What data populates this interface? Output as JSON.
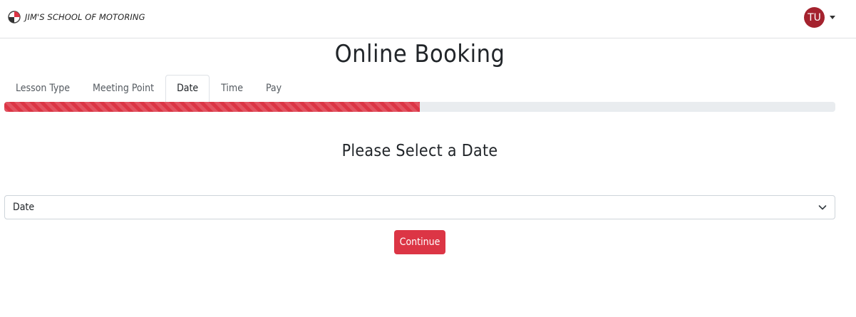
{
  "header": {
    "brand": "JIM'S SCHOOL OF MOTORING",
    "brand_logo": "steering-wheel-logo",
    "user_initials": "TU",
    "user_menu_icon": "caret-down-icon"
  },
  "page": {
    "title": "Online Booking"
  },
  "tabs": [
    {
      "label": "Lesson Type",
      "active": false
    },
    {
      "label": "Meeting Point",
      "active": false
    },
    {
      "label": "Date",
      "active": true
    },
    {
      "label": "Time",
      "active": false
    },
    {
      "label": "Pay",
      "active": false
    }
  ],
  "progress": {
    "percent": 50,
    "style": "striped"
  },
  "step": {
    "heading": "Please Select a Date"
  },
  "date_select": {
    "value": "Date",
    "icon": "chevron-down-icon"
  },
  "actions": {
    "continue_label": "Continue"
  },
  "colors": {
    "accent": "#dc3545",
    "avatar": "#a4222e",
    "progress_track": "#e9ecef"
  }
}
